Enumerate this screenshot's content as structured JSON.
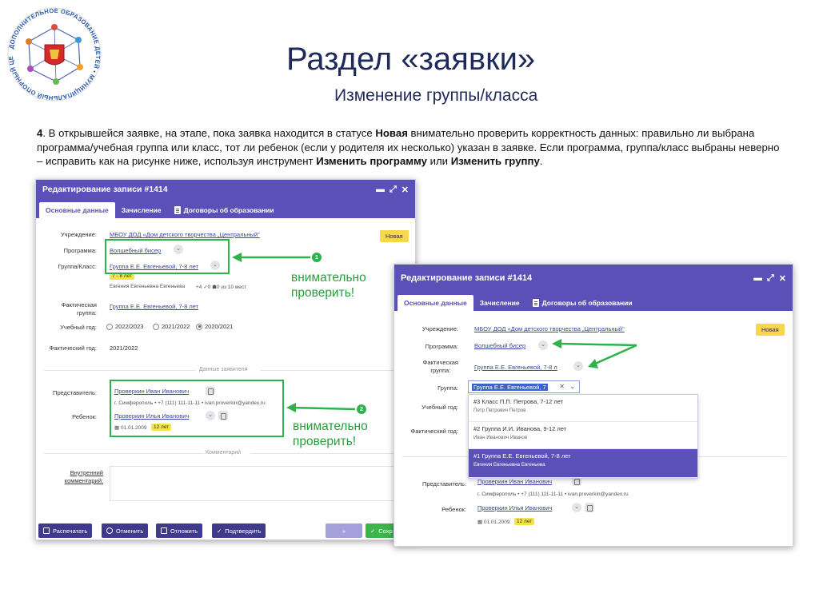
{
  "logo": {
    "ring_text": "ДОПОЛНИТЕЛЬНОЕ ОБРАЗОВАНИЕ ДЕТЕЙ • МУНИЦИПАЛЬНЫЙ ОПОРНЫЙ ЦЕНТР"
  },
  "slide": {
    "title": "Раздел «заявки»",
    "subtitle": "Изменение группы/класса",
    "instr": {
      "num": "4",
      "p1": ". В открывшейся заявке, на этапе, пока заявка находится в статусе ",
      "status": "Новая",
      "p2": " внимательно проверить корректность данных: правильно ли выбрана программа/учебная группа или класс, тот ли ребенок (если у родителя их несколько) указан в заявке. Если программа, группа/класс выбраны неверно – исправить как на рисунке ниже, используя инструмент ",
      "tool1": "Изменить программу",
      "or": " или ",
      "tool2": "Изменить группу",
      "end": "."
    }
  },
  "win1": {
    "title": "Редактирование записи #1414",
    "controls": {
      "minimize": "▬",
      "expand": "⤢",
      "close": "✕"
    },
    "tabs": [
      "Основные данные",
      "Зачисление",
      "Договоры об образовании"
    ],
    "status": "Новая",
    "fields": {
      "institution_label": "Учреждение:",
      "institution": "МБОУ ДОД «Дом детского творчества „Центральный\"",
      "program_label": "Программа:",
      "program": "Волшебный бисер",
      "group_label": "Группа/Класс:",
      "group": "Группа Е.Е. Евгеньевой, 7-8 лет",
      "age": "7 - 8 лет",
      "teacher": "Евгения Евгеньевна Евгеньева",
      "stats": "+4   ✓0   ☗0   из 10 мест",
      "actual_label_1": "Фактическая",
      "actual_label_2": "группа:",
      "actual_group": "Группа Е.Е. Евгеньевой, 7-8 лет",
      "year_label": "Учебный год:",
      "years": [
        "2022/2023",
        "2021/2022",
        "2020/2021"
      ],
      "actual_year_label": "Фактический год:",
      "actual_year": "2021/2022",
      "applicant_section": "Данные заявителя",
      "rep_label": "Представитель:",
      "rep": "Проверкин Иван Иванович",
      "rep_contacts": "г. Симферополь • +7 (111) 111-11-11 • ivan.proverkin@yandex.ru",
      "child_label": "Ребенок:",
      "child": "Проверкин Илья Иванович",
      "child_dob": "01.01.2009",
      "child_age": "12 лет",
      "comment_section": "Комментарий",
      "comment_label_1": "Внутренний",
      "comment_label_2": "комментарий:"
    },
    "buttons": [
      "Распечатать",
      "Отменить",
      "Отложить",
      "Подтвердить",
      "Сохр"
    ],
    "annotations": [
      {
        "num": "1",
        "text_1": "внимательно",
        "text_2": "проверить!"
      },
      {
        "num": "2",
        "text_1": "внимательно",
        "text_2": "проверить!"
      }
    ]
  },
  "win2": {
    "title": "Редактирование записи #1414",
    "controls": {
      "minimize": "▬",
      "expand": "⤢",
      "close": "✕"
    },
    "tabs": [
      "Основные данные",
      "Зачисление",
      "Договоры об образовании"
    ],
    "status": "Новая",
    "fields": {
      "institution_label": "Учреждение:",
      "institution": "МБОУ ДОД «Дом детского творчества „Центральный\"",
      "program_label": "Программа:",
      "program": "Волшебный бисер",
      "actual_label_1": "Фактическая",
      "actual_label_2": "группа:",
      "actual_group": "Группа Е.Е. Евгеньевой, 7-8 л",
      "group_label": "Группа:",
      "group_selected": "Группа Е.Е. Евгеньевой, 7",
      "year_label": "Учебный год:",
      "actual_year_label": "Фактический год:",
      "rep_label": "Представитель:",
      "rep": "Проверкин Иван Иванович",
      "rep_contacts": "г. Симферополь • +7 (111) 111-11-11 • ivan.proverkin@yandex.ru",
      "child_label": "Ребенок:",
      "child": "Проверкин Илья Иванович",
      "child_dob": "01.01.2009",
      "child_age": "12 лет"
    },
    "dropdown": [
      {
        "title": "#3 Класс П.П. Петрова, 7-12 лет",
        "sub": "Петр Петрович Петров"
      },
      {
        "title": "#2 Группа И.И. Иванова, 9-12 лет",
        "sub": "Иван Иванович Иванов"
      },
      {
        "title": "#1 Группа Е.Е. Евгеньевой, 7-8 лет",
        "sub": "Евгения Евгеньевна Евгеньева",
        "selected": true
      }
    ]
  },
  "colors": {
    "header": "#5a50b8",
    "highlight": "#2db34a",
    "annotation_text": "#2a9c3e",
    "badge": "#f6d84a",
    "title": "#1f2a5a"
  }
}
